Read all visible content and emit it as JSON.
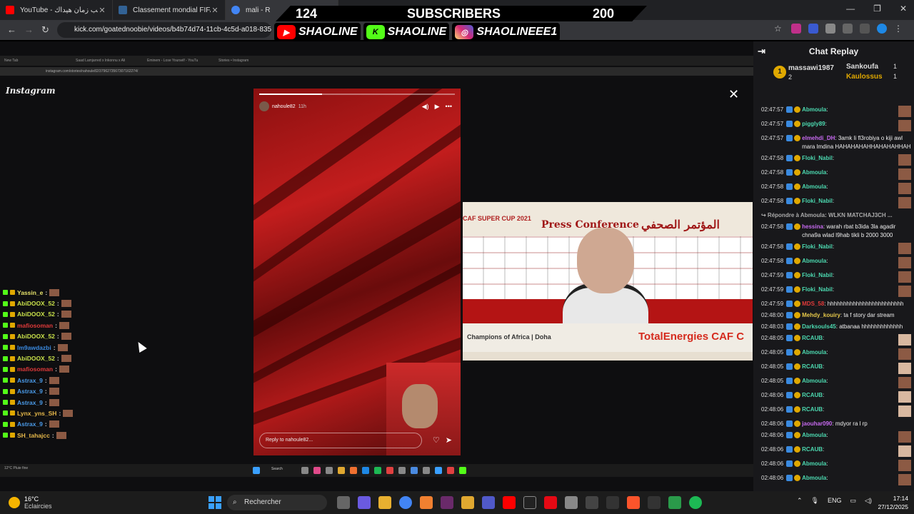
{
  "browser": {
    "tabs": [
      {
        "title": "YouTube - منتخب زمان هيداك",
        "favicon_color": "#ff0000"
      },
      {
        "title": "Classement mondial FIFA/Coca",
        "favicon_color": "#326295"
      },
      {
        "title": "mali - R",
        "favicon_color": "#4285f4"
      }
    ],
    "url": "kick.com/goatednoobie/videos/b4b74d74-11cb-4c5d-a018-83551c"
  },
  "overlay": {
    "subs_left": "124",
    "subs_label": "SUBSCRIBERS",
    "subs_right": "200",
    "socials": [
      {
        "name": "SHAOLINE",
        "icon": "youtube-icon",
        "color": "#ff0000"
      },
      {
        "name": "SHAOLINE",
        "icon": "kick-icon",
        "color": "#53fc18"
      },
      {
        "name": "SHAOLINEEE1",
        "icon": "instagram-icon",
        "color": "#d62976"
      }
    ]
  },
  "stream": {
    "inner_tabs": [
      "New Tab",
      "Saad Lamjarred x Inkonnu x Ali",
      "Eminem - Lose Yourself - YouTu",
      "Stories • Instagram"
    ],
    "inner_url": "instagram.com/stories/nahoule82/3796273567307162274/",
    "instagram_logo": "Instagram",
    "story_user": "nahoule82",
    "story_time": "11h",
    "story_reply": "Reply to nahoule82...",
    "press": {
      "cup_text": "CAF SUPER CUP 2021",
      "title_en": "Press Conference",
      "title_ar": "المؤتمر الصحفي",
      "bottom_left": "Champions of Africa | Doha",
      "bottom_right": "TotalEnergies CAF C"
    },
    "left_chat": [
      {
        "user": "Yassin_e",
        "color": "#e6e26a"
      },
      {
        "user": "AbiDOOX_52",
        "color": "#c8e04a"
      },
      {
        "user": "AbiDOOX_52",
        "color": "#c8e04a"
      },
      {
        "user": "mafiosoman",
        "color": "#e03a3a"
      },
      {
        "user": "AbiDOOX_52",
        "color": "#c8e04a"
      },
      {
        "user": "lm9awdazbi",
        "color": "#3a8ae0"
      },
      {
        "user": "AbiDOOX_52",
        "color": "#c8e04a"
      },
      {
        "user": "mafiosoman",
        "color": "#e03a3a"
      },
      {
        "user": "Astrax_9",
        "color": "#4a9ae8"
      },
      {
        "user": "Astrax_9",
        "color": "#4a9ae8"
      },
      {
        "user": "Astrax_9",
        "color": "#4a9ae8"
      },
      {
        "user": "Lynx_yns_SH",
        "color": "#e6b84a"
      },
      {
        "user": "Astrax_9",
        "color": "#4a9ae8"
      },
      {
        "user": "SH_tahajcc",
        "color": "#e6b84a"
      }
    ],
    "inner_weather": "12°C Pluie fine",
    "inner_search": "Search"
  },
  "chat": {
    "title": "Chat Replay",
    "leaderboard": {
      "first_user": "massawi1987",
      "first_count": "2",
      "second_user": "Sankoufa",
      "second_count": "1",
      "third_user": "Kaulossus",
      "third_count": "1",
      "medal": "1"
    },
    "messages": [
      {
        "ts": "02:47:57",
        "user": "Abmoula",
        "color": "#4cd9b0",
        "text": "",
        "emote": true
      },
      {
        "ts": "02:47:57",
        "user": "piggly89",
        "color": "#4cd9b0",
        "text": "",
        "emote": true
      },
      {
        "ts": "02:47:57",
        "user": "elmehdi_DH",
        "color": "#c76af0",
        "text": "3amk li fl3robiya o kiji awl mara lmdina HAHAHAHAHHAHAHAHHAH",
        "emote": false
      },
      {
        "ts": "02:47:58",
        "user": "Floki_Nabil",
        "color": "#4cd9b0",
        "text": "",
        "emote": true
      },
      {
        "ts": "02:47:58",
        "user": "Abmoula",
        "color": "#4cd9b0",
        "text": "",
        "emote": true
      },
      {
        "ts": "02:47:58",
        "user": "Abmoula",
        "color": "#4cd9b0",
        "text": "",
        "emote": true
      },
      {
        "ts": "02:47:58",
        "user": "Floki_Nabil",
        "color": "#4cd9b0",
        "text": "",
        "emote": true
      },
      {
        "ts": "",
        "user": "↪ Répondre à Abmoula: WLKN MATCHAJ3CH ...",
        "color": "#aaaaaa",
        "text": "",
        "emote": false
      },
      {
        "ts": "02:47:58",
        "user": "hessina",
        "color": "#c76af0",
        "text": "warah rbat b3ida 3la agadir chna9a wlad l9hab tikli b 2000 3000",
        "emote": false
      },
      {
        "ts": "02:47:58",
        "user": "Floki_Nabil",
        "color": "#4cd9b0",
        "text": "",
        "emote": true
      },
      {
        "ts": "02:47:58",
        "user": "Abmoula",
        "color": "#4cd9b0",
        "text": "",
        "emote": true
      },
      {
        "ts": "02:47:59",
        "user": "Floki_Nabil",
        "color": "#4cd9b0",
        "text": "",
        "emote": true
      },
      {
        "ts": "02:47:59",
        "user": "Floki_Nabil",
        "color": "#4cd9b0",
        "text": "",
        "emote": true
      },
      {
        "ts": "02:47:59",
        "user": "MDS_58",
        "color": "#e03a3a",
        "text": "hhhhhhhhhhhhhhhhhhhhhhhh",
        "emote": false
      },
      {
        "ts": "02:48:00",
        "user": "Mehdy_kouiry",
        "color": "#e6c84a",
        "text": "ta f story dar stream",
        "emote": false
      },
      {
        "ts": "02:48:03",
        "user": "Darksouls45",
        "color": "#4cd9b0",
        "text": "atbanaa hhhhhhhhhhhhh",
        "emote": false
      },
      {
        "ts": "02:48:05",
        "user": "RCAUB",
        "color": "#4cd9b0",
        "text": "",
        "emote": true
      },
      {
        "ts": "02:48:05",
        "user": "Abmoula",
        "color": "#4cd9b0",
        "text": "",
        "emote": true
      },
      {
        "ts": "02:48:05",
        "user": "RCAUB",
        "color": "#4cd9b0",
        "text": "",
        "emote": true
      },
      {
        "ts": "02:48:05",
        "user": "Abmoula",
        "color": "#4cd9b0",
        "text": "",
        "emote": true
      },
      {
        "ts": "02:48:06",
        "user": "RCAUB",
        "color": "#4cd9b0",
        "text": "",
        "emote": true
      },
      {
        "ts": "02:48:06",
        "user": "RCAUB",
        "color": "#4cd9b0",
        "text": "",
        "emote": true
      },
      {
        "ts": "02:48:06",
        "user": "jaouhar090",
        "color": "#c76af0",
        "text": "mdyor ra l rp",
        "emote": false
      },
      {
        "ts": "02:48:06",
        "user": "Abmoula",
        "color": "#4cd9b0",
        "text": "",
        "emote": true
      },
      {
        "ts": "02:48:06",
        "user": "RCAUB",
        "color": "#4cd9b0",
        "text": "",
        "emote": true
      },
      {
        "ts": "02:48:06",
        "user": "Abmoula",
        "color": "#4cd9b0",
        "text": "",
        "emote": true
      },
      {
        "ts": "02:48:06",
        "user": "Abmoula",
        "color": "#4cd9b0",
        "text": "",
        "emote": true
      }
    ]
  },
  "taskbar": {
    "temp": "16°C",
    "condition": "Eclaircies",
    "search_placeholder": "Rechercher",
    "lang": "ENG",
    "time": "17:14",
    "date": "27/12/2025"
  }
}
